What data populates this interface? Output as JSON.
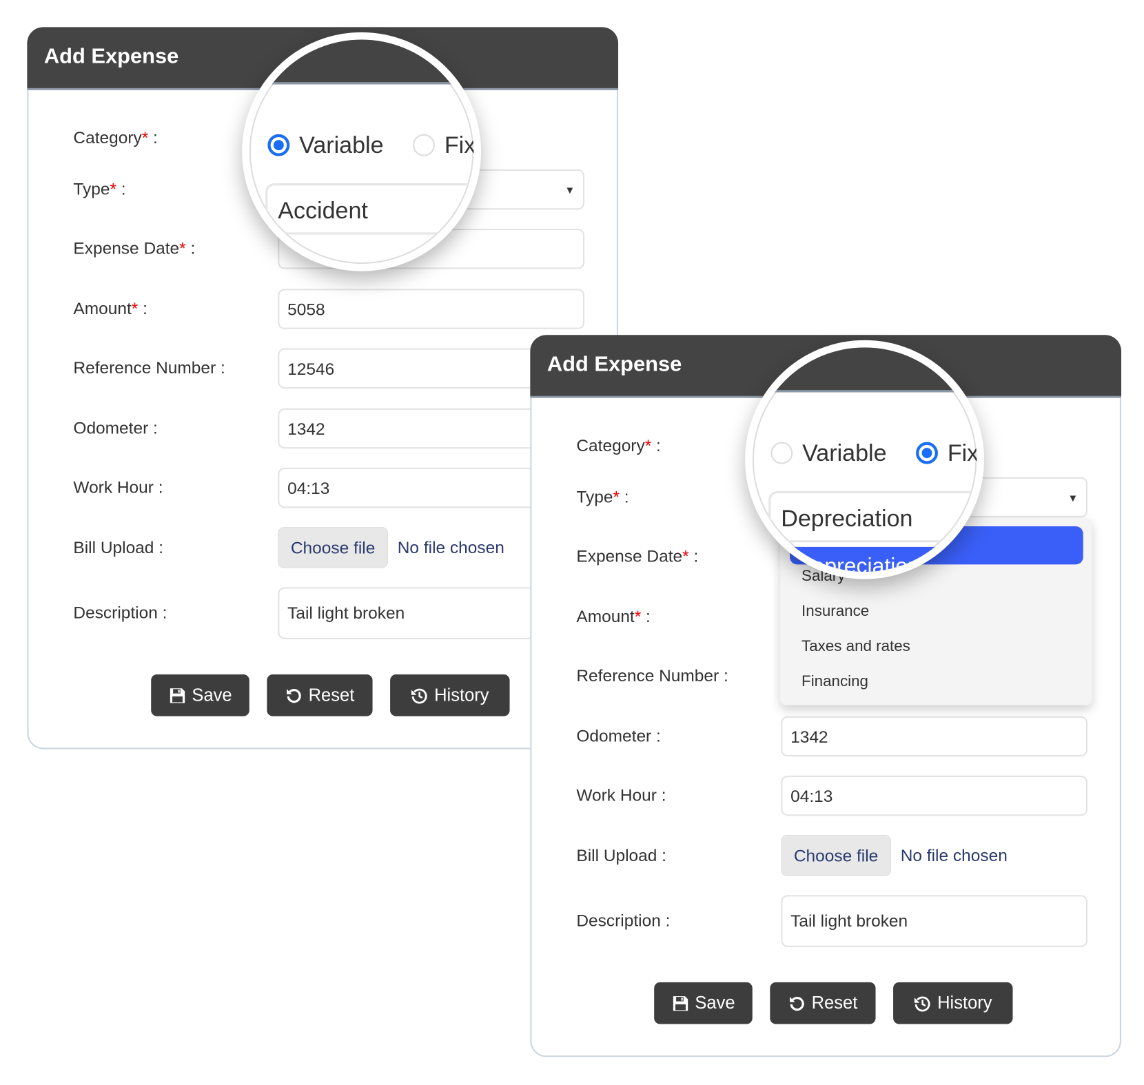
{
  "accent_color": "#1a6ef5",
  "highlight_color": "#3a5ff8",
  "header_color": "#444444",
  "panels": [
    {
      "title": "Add Expense",
      "category": {
        "label": "Category",
        "required": "*",
        "options": [
          "Variable",
          "Fix"
        ],
        "selected": "Variable"
      },
      "type": {
        "label": "Type",
        "required": "*",
        "value": "Accident",
        "dropdown_open": false
      },
      "fields": [
        {
          "label": "Expense Date",
          "required": "*",
          "value": ""
        },
        {
          "label": "Amount",
          "required": "*",
          "value": "5058"
        },
        {
          "label": "Reference Number",
          "required": "",
          "value": "12546"
        },
        {
          "label": "Odometer",
          "required": "",
          "value": "1342"
        },
        {
          "label": "Work Hour",
          "required": "",
          "value": "04:13"
        }
      ],
      "bill_upload": {
        "label": "Bill Upload",
        "button": "Choose file",
        "status": "No file chosen"
      },
      "description": {
        "label": "Description",
        "value": "Tail light broken"
      },
      "buttons": [
        {
          "label": "Save",
          "icon": "floppy-disk-icon"
        },
        {
          "label": "Reset",
          "icon": "reset-icon"
        },
        {
          "label": "History",
          "icon": "history-icon"
        }
      ]
    },
    {
      "title": "Add Expense",
      "category": {
        "label": "Category",
        "required": "*",
        "options": [
          "Variable",
          "Fix"
        ],
        "selected": "Fix"
      },
      "type": {
        "label": "Type",
        "required": "*",
        "value": "Depreciation",
        "dropdown_open": true,
        "options": [
          "Depreciation",
          "Salary",
          "Insurance",
          "Taxes and rates",
          "Financing"
        ]
      },
      "fields": [
        {
          "label": "Expense Date",
          "required": "*",
          "value": ""
        },
        {
          "label": "Amount",
          "required": "*",
          "value": ""
        },
        {
          "label": "Reference Number",
          "required": "",
          "value": ""
        },
        {
          "label": "Odometer",
          "required": "",
          "value": "1342"
        },
        {
          "label": "Work Hour",
          "required": "",
          "value": "04:13"
        }
      ],
      "bill_upload": {
        "label": "Bill Upload",
        "button": "Choose file",
        "status": "No file chosen"
      },
      "description": {
        "label": "Description",
        "value": "Tail light broken"
      },
      "buttons": [
        {
          "label": "Save",
          "icon": "floppy-disk-icon"
        },
        {
          "label": "Reset",
          "icon": "reset-icon"
        },
        {
          "label": "History",
          "icon": "history-icon"
        }
      ]
    }
  ]
}
